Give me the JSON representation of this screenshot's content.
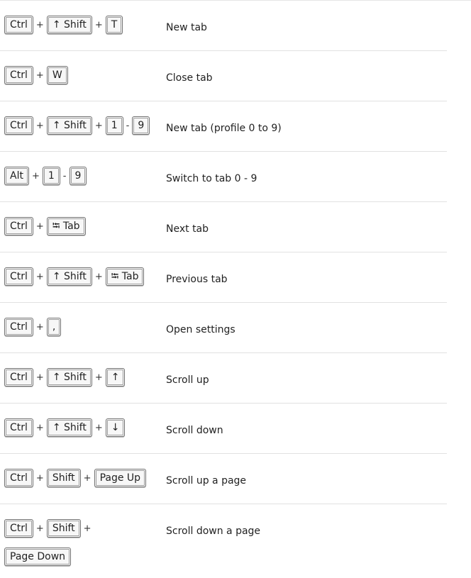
{
  "shortcuts": [
    {
      "keys": [
        "Ctrl",
        "↑  Shift",
        "T"
      ],
      "seps": [
        "+",
        "+"
      ],
      "action": "New tab"
    },
    {
      "keys": [
        "Ctrl",
        "W"
      ],
      "seps": [
        "+"
      ],
      "action": "Close tab"
    },
    {
      "keys": [
        "Ctrl",
        "↑  Shift",
        "1",
        "9"
      ],
      "seps": [
        "+",
        "+",
        "-"
      ],
      "action": "New tab (profile 0 to 9)"
    },
    {
      "keys": [
        "Alt",
        "1",
        "9"
      ],
      "seps": [
        "+",
        "-"
      ],
      "action": "Switch to tab 0 - 9"
    },
    {
      "keys": [
        "Ctrl",
        "⭾ Tab"
      ],
      "seps": [
        "+"
      ],
      "action": "Next tab"
    },
    {
      "keys": [
        "Ctrl",
        "↑  Shift",
        "⭾ Tab"
      ],
      "seps": [
        "+",
        "+"
      ],
      "action": "Previous tab"
    },
    {
      "keys": [
        "Ctrl",
        ","
      ],
      "seps": [
        "+"
      ],
      "action": "Open settings"
    },
    {
      "keys": [
        "Ctrl",
        "↑  Shift",
        "↑"
      ],
      "seps": [
        "+",
        "+"
      ],
      "action": "Scroll up"
    },
    {
      "keys": [
        "Ctrl",
        "↑  Shift",
        "↓"
      ],
      "seps": [
        "+",
        "+"
      ],
      "action": "Scroll down"
    },
    {
      "keys": [
        "Ctrl",
        "Shift",
        "Page Up"
      ],
      "seps": [
        "+",
        "+"
      ],
      "action": "Scroll up a page"
    },
    {
      "keys": [
        "Ctrl",
        "Shift",
        "Page Down"
      ],
      "seps": [
        "+",
        "+"
      ],
      "action": "Scroll down a page"
    }
  ]
}
